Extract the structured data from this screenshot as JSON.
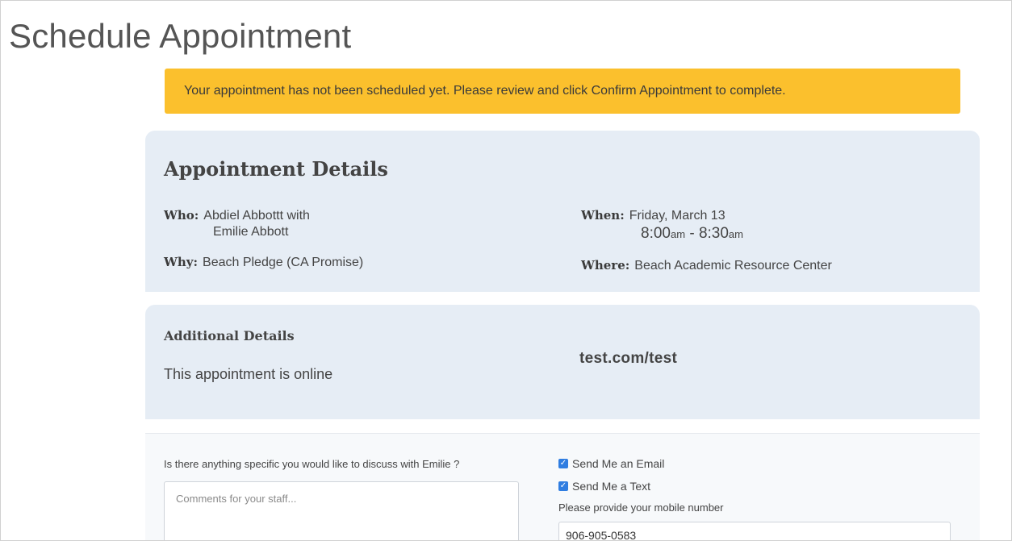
{
  "page": {
    "title": "Schedule Appointment"
  },
  "alert": {
    "message": "Your appointment has not been scheduled yet. Please review and click Confirm Appointment to complete.",
    "color": "#fbc02d"
  },
  "details": {
    "heading": "Appointment Details",
    "who_label": "Who:",
    "who_line1": "Abdiel Abbottt with",
    "who_line2": "Emilie Abbott",
    "why_label": "Why:",
    "why_value": "Beach Pledge (CA Promise)",
    "when_label": "When:",
    "when_date": "Friday, March 13",
    "when_start": "8:00",
    "when_start_suffix": "am",
    "when_separator": " - ",
    "when_end": "8:30",
    "when_end_suffix": "am",
    "where_label": "Where:",
    "where_value": "Beach Academic Resource Center",
    "card_color": "#e6edf5"
  },
  "additional": {
    "heading": "Additional Details",
    "text": "This appointment is online",
    "link": "test.com/test"
  },
  "form": {
    "discuss_label": "Is there anything specific you would like to discuss with Emilie ?",
    "comments_placeholder": "Comments for your staff...",
    "email_label": "Send Me an Email",
    "email_checked": true,
    "text_label": "Send Me a Text",
    "text_checked": true,
    "mobile_label": "Please provide your mobile number",
    "mobile_value": "906-905-0583",
    "checkbox_color": "#2f7de1"
  }
}
